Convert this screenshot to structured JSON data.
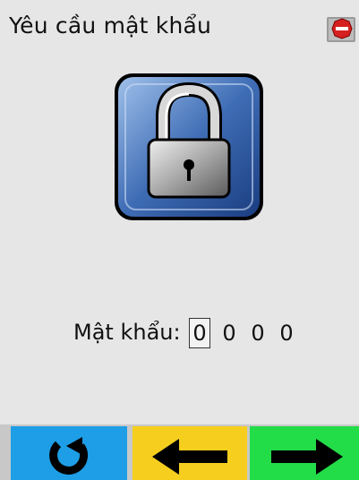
{
  "header": {
    "title": "Yêu cầu mật khẩu",
    "status_icon": "stop-sign-icon"
  },
  "main": {
    "lock_icon": "padlock-icon"
  },
  "password": {
    "label": "Mật khẩu:",
    "digits": [
      "0",
      "0",
      "0",
      "0"
    ],
    "selected_index": 0
  },
  "buttons": {
    "reset": {
      "icon": "refresh-icon",
      "color": "#1e9ee6"
    },
    "back": {
      "icon": "arrow-left-icon",
      "color": "#f6cf1e"
    },
    "next": {
      "icon": "arrow-right-icon",
      "color": "#22dc48"
    }
  }
}
